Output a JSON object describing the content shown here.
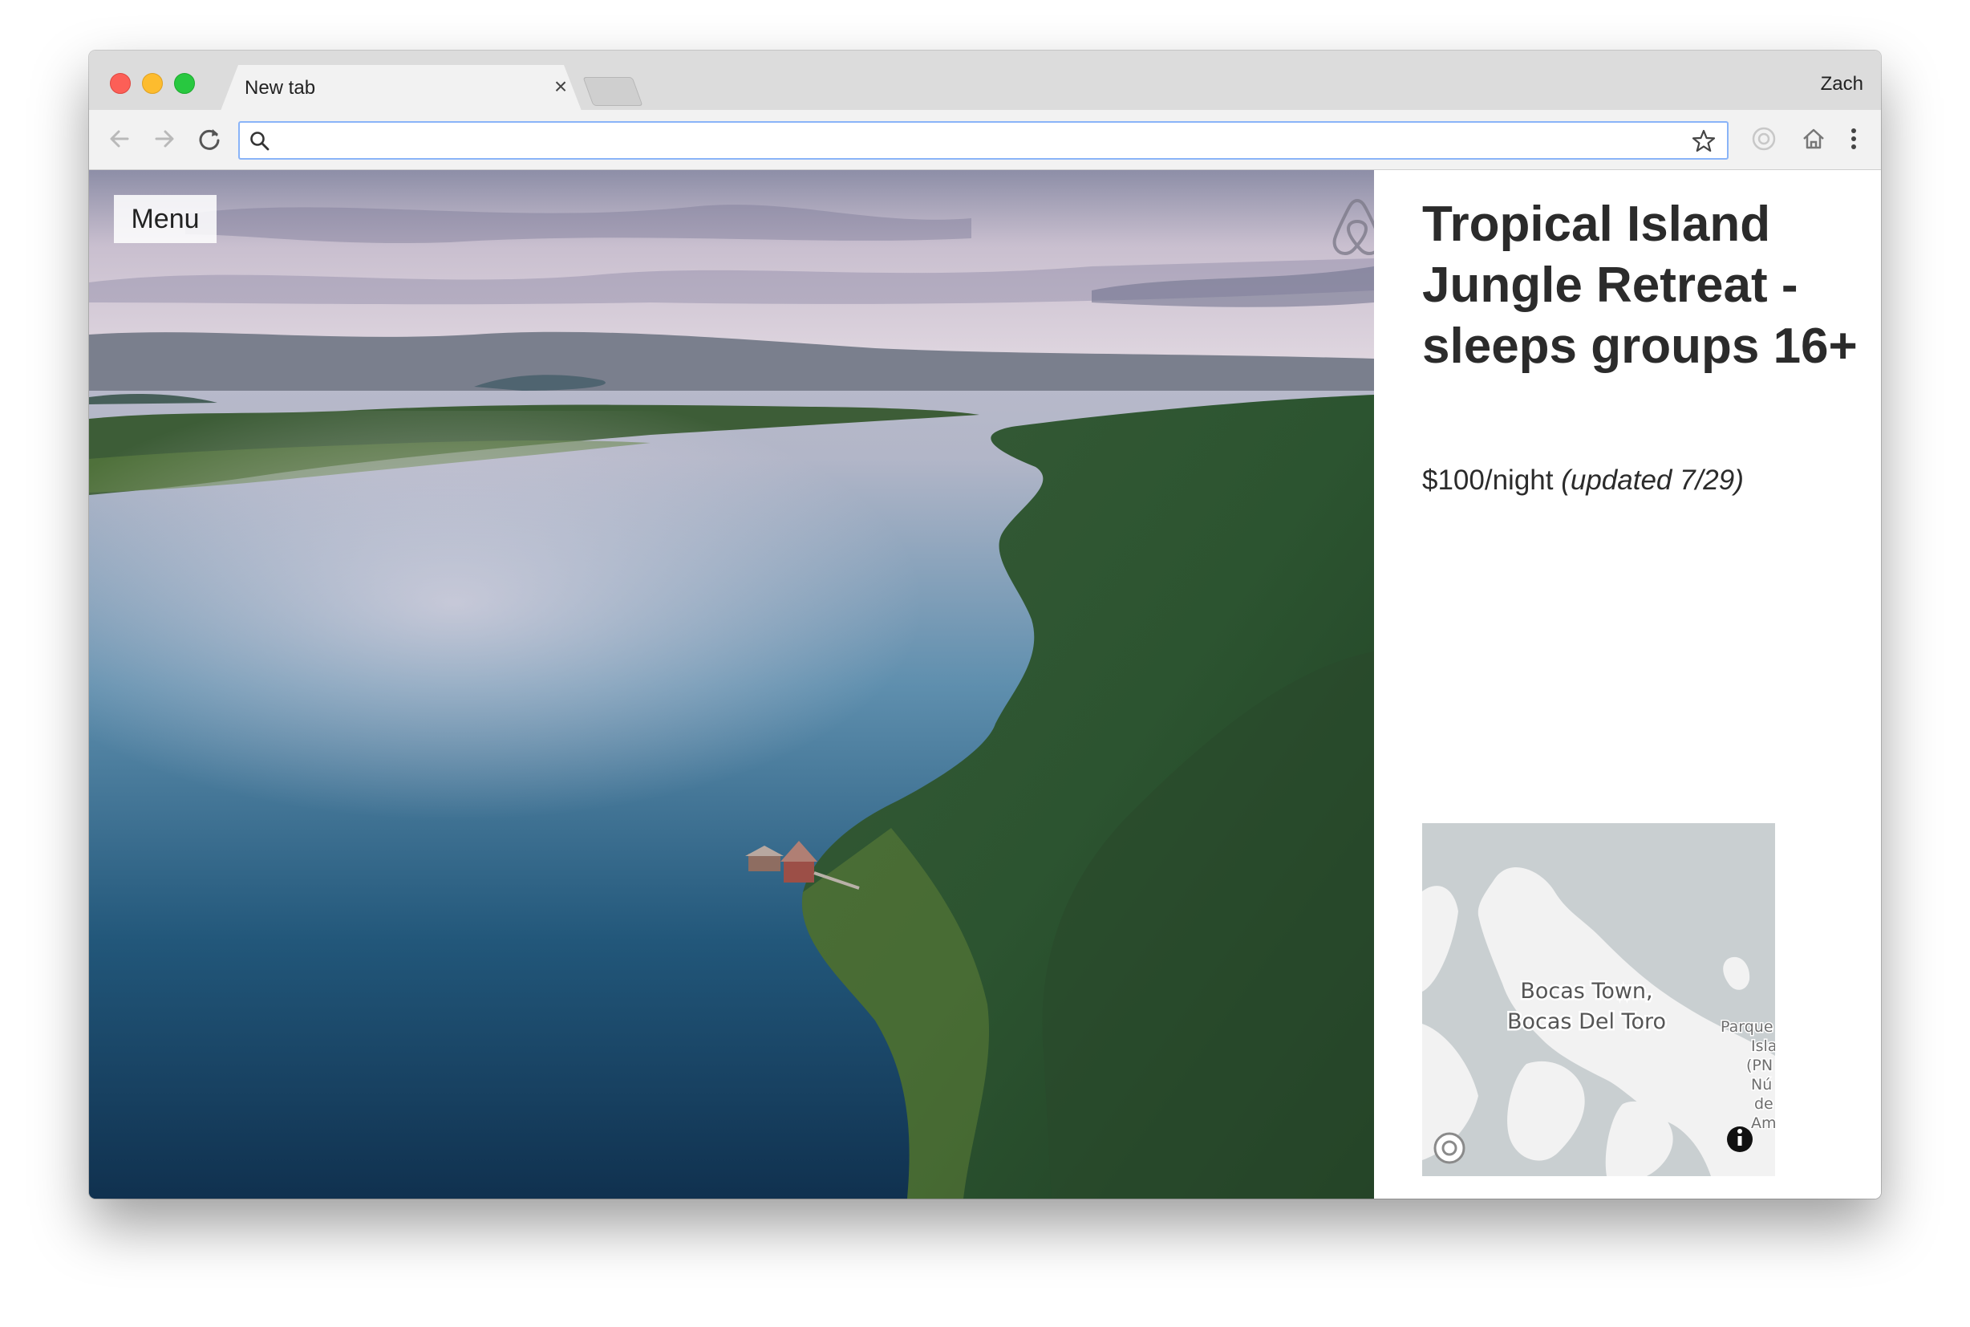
{
  "browser": {
    "tab_title": "New tab",
    "tab_close_glyph": "×",
    "profile_name": "Zach",
    "address_value": "",
    "address_placeholder": "",
    "icons": [
      "back-arrow-icon",
      "forward-arrow-icon",
      "reload-icon",
      "search-icon",
      "bookmark-star-icon",
      "extension-icon",
      "home-icon",
      "more-menu-icon"
    ]
  },
  "page": {
    "menu_label": "Menu",
    "listing_title": "Tropical Island Jungle Retreat - sleeps groups 16+",
    "price": "$100/night",
    "updated": "(updated 7/29)",
    "map": {
      "label_line1": "Bocas Town,",
      "label_line2": "Bocas Del Toro",
      "edge_label": [
        "Parque",
        "Isla",
        "(PN",
        "Nú",
        "de",
        "Am"
      ]
    }
  },
  "colors": {
    "accent_focus": "#8ab4f8",
    "title_text": "#2b2b2b",
    "map_water": "#c9cfd1",
    "map_land": "#f2f2f2"
  }
}
